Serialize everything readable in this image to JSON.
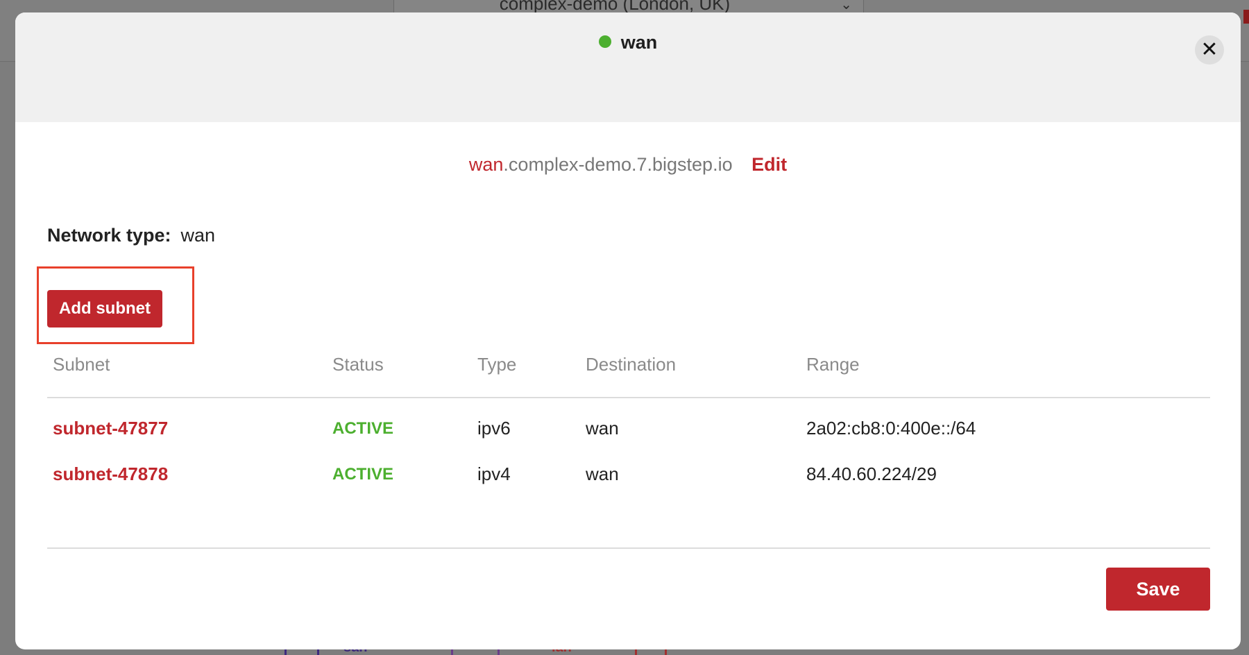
{
  "background": {
    "selector_text": "complex-demo (London, UK)",
    "bottom_labels": [
      "san",
      "lan"
    ]
  },
  "modal": {
    "title": "wan",
    "status_color": "#4caf2f",
    "close_icon": "close-icon",
    "hostname_prefix": "wan",
    "hostname_suffix": ".complex-demo.7.bigstep.io",
    "edit_label": "Edit",
    "network_type_label": "Network type:",
    "network_type_value": "wan",
    "add_subnet_label": "Add subnet",
    "save_label": "Save"
  },
  "table": {
    "headers": [
      "Subnet",
      "Status",
      "Type",
      "Destination",
      "Range"
    ],
    "rows": [
      {
        "subnet": "subnet-47877",
        "status": "ACTIVE",
        "type": "ipv6",
        "destination": "wan",
        "range": "2a02:cb8:0:400e::/64"
      },
      {
        "subnet": "subnet-47878",
        "status": "ACTIVE",
        "type": "ipv4",
        "destination": "wan",
        "range": "84.40.60.224/29"
      }
    ]
  },
  "colors": {
    "accent": "#c0272d",
    "active": "#4caf2f",
    "highlight": "#e8402b"
  }
}
